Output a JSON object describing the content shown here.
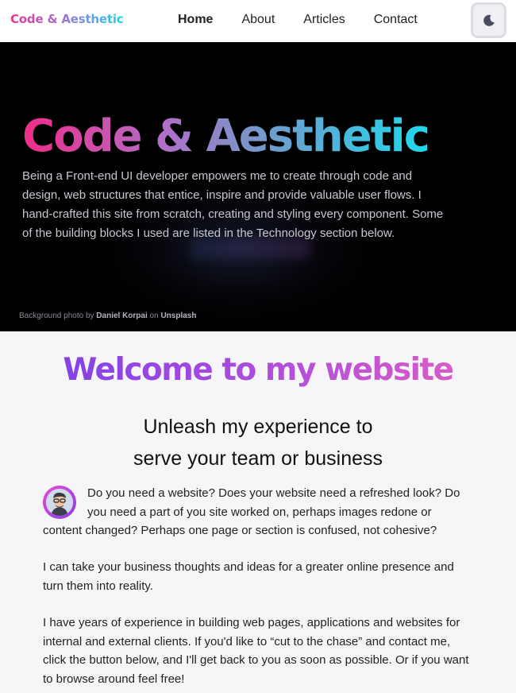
{
  "header": {
    "logo": "Code & Aesthetic",
    "nav": [
      "Home",
      "About",
      "Articles",
      "Contact"
    ],
    "active_nav": "Home",
    "theme_toggle_icon": "moon-icon"
  },
  "hero": {
    "title": "Code & Aesthetic",
    "text": "Being a Front-end UI developer empowers me to create through code and design, web structures that entice, inspire and provide valuable user flows. I hand-crafted this site from scratch, creating and styling every component. Some of the building blocks I used are listed in the Technology section below.",
    "credit_prefix": "Background photo by",
    "credit_author": "Daniel Korpai",
    "credit_on": "on",
    "credit_site": "Unsplash"
  },
  "main": {
    "welcome": "Welcome to my website",
    "subtitle_line1": "Unleash my experience to",
    "subtitle_line2": "serve your team or business",
    "paragraph1": "Do you need a website? Does your website need a refreshed look? Do you need a part of you site worked on, perhaps images redone or content changed? Perhaps one page or section is confused, not cohesive?",
    "paragraph2": "I can take your business thoughts and ideas for a greater online presence and turn them into reality.",
    "paragraph3": "I have years of experience in building web pages, applications and websites for internal and external clients. If you'd like to “cut to the chase” and contact me, click the button below, and I'll get back to you as soon as possible. Or if you want to browse around feel free!"
  },
  "colors": {
    "logo_gradient": [
      "#e8348d",
      "#a26fd6",
      "#19d4f0"
    ],
    "welcome_gradient": [
      "#8442e6",
      "#d65cc6"
    ],
    "hero_background": "#000000",
    "page_background": "#f6f6f8"
  }
}
